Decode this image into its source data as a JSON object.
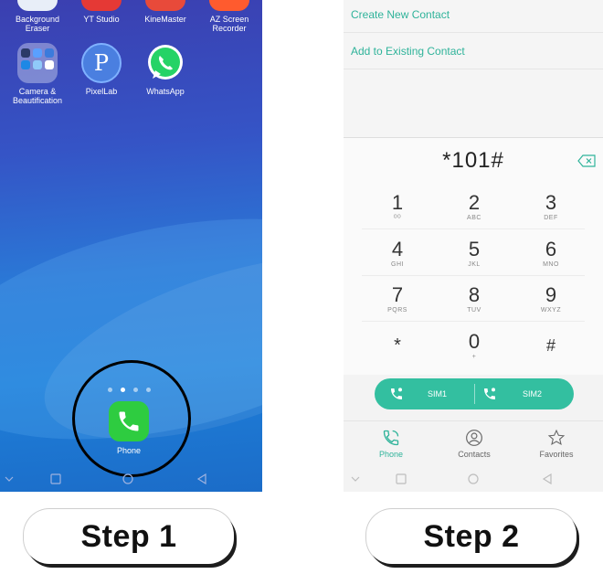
{
  "home_screen": {
    "top_apps": [
      {
        "label": "Background Eraser",
        "icon": "background-eraser-icon"
      },
      {
        "label": "YT Studio",
        "icon": "yt-studio-icon"
      },
      {
        "label": "KineMaster",
        "icon": "kinemaster-icon"
      },
      {
        "label": "AZ Screen Recorder",
        "icon": "az-screen-recorder-icon"
      }
    ],
    "apps": [
      {
        "label": "Camera & Beautification",
        "icon": "camera-folder-icon"
      },
      {
        "label": "PixelLab",
        "icon": "pixellab-icon",
        "glyph": "P"
      },
      {
        "label": "WhatsApp",
        "icon": "whatsapp-icon"
      }
    ],
    "page_indicator": {
      "count": 4,
      "active": 1
    },
    "dock_app": {
      "label": "Phone",
      "icon": "phone-icon"
    }
  },
  "dialer": {
    "menu": [
      {
        "label": "Create New Contact"
      },
      {
        "label": "Add to Existing Contact"
      }
    ],
    "number": "*101#",
    "keys": [
      {
        "digit": "1",
        "letters": "ᴼᴼ"
      },
      {
        "digit": "2",
        "letters": "ABC"
      },
      {
        "digit": "3",
        "letters": "DEF"
      },
      {
        "digit": "4",
        "letters": "GHI"
      },
      {
        "digit": "5",
        "letters": "JKL"
      },
      {
        "digit": "6",
        "letters": "MNO"
      },
      {
        "digit": "7",
        "letters": "PQRS"
      },
      {
        "digit": "8",
        "letters": "TUV"
      },
      {
        "digit": "9",
        "letters": "WXYZ"
      },
      {
        "digit": "*",
        "letters": ""
      },
      {
        "digit": "0",
        "letters": "+"
      },
      {
        "digit": "#",
        "letters": ""
      }
    ],
    "sim_buttons": [
      {
        "label": "SIM1"
      },
      {
        "label": "SIM2"
      }
    ],
    "tabs": [
      {
        "label": "Phone",
        "icon": "phone-tab-icon",
        "active": true
      },
      {
        "label": "Contacts",
        "icon": "contacts-tab-icon",
        "active": false
      },
      {
        "label": "Favorites",
        "icon": "favorites-tab-icon",
        "active": false
      }
    ],
    "accent_color": "#2fb39a"
  },
  "steps": [
    {
      "label": "Step 1"
    },
    {
      "label": "Step 2"
    }
  ]
}
